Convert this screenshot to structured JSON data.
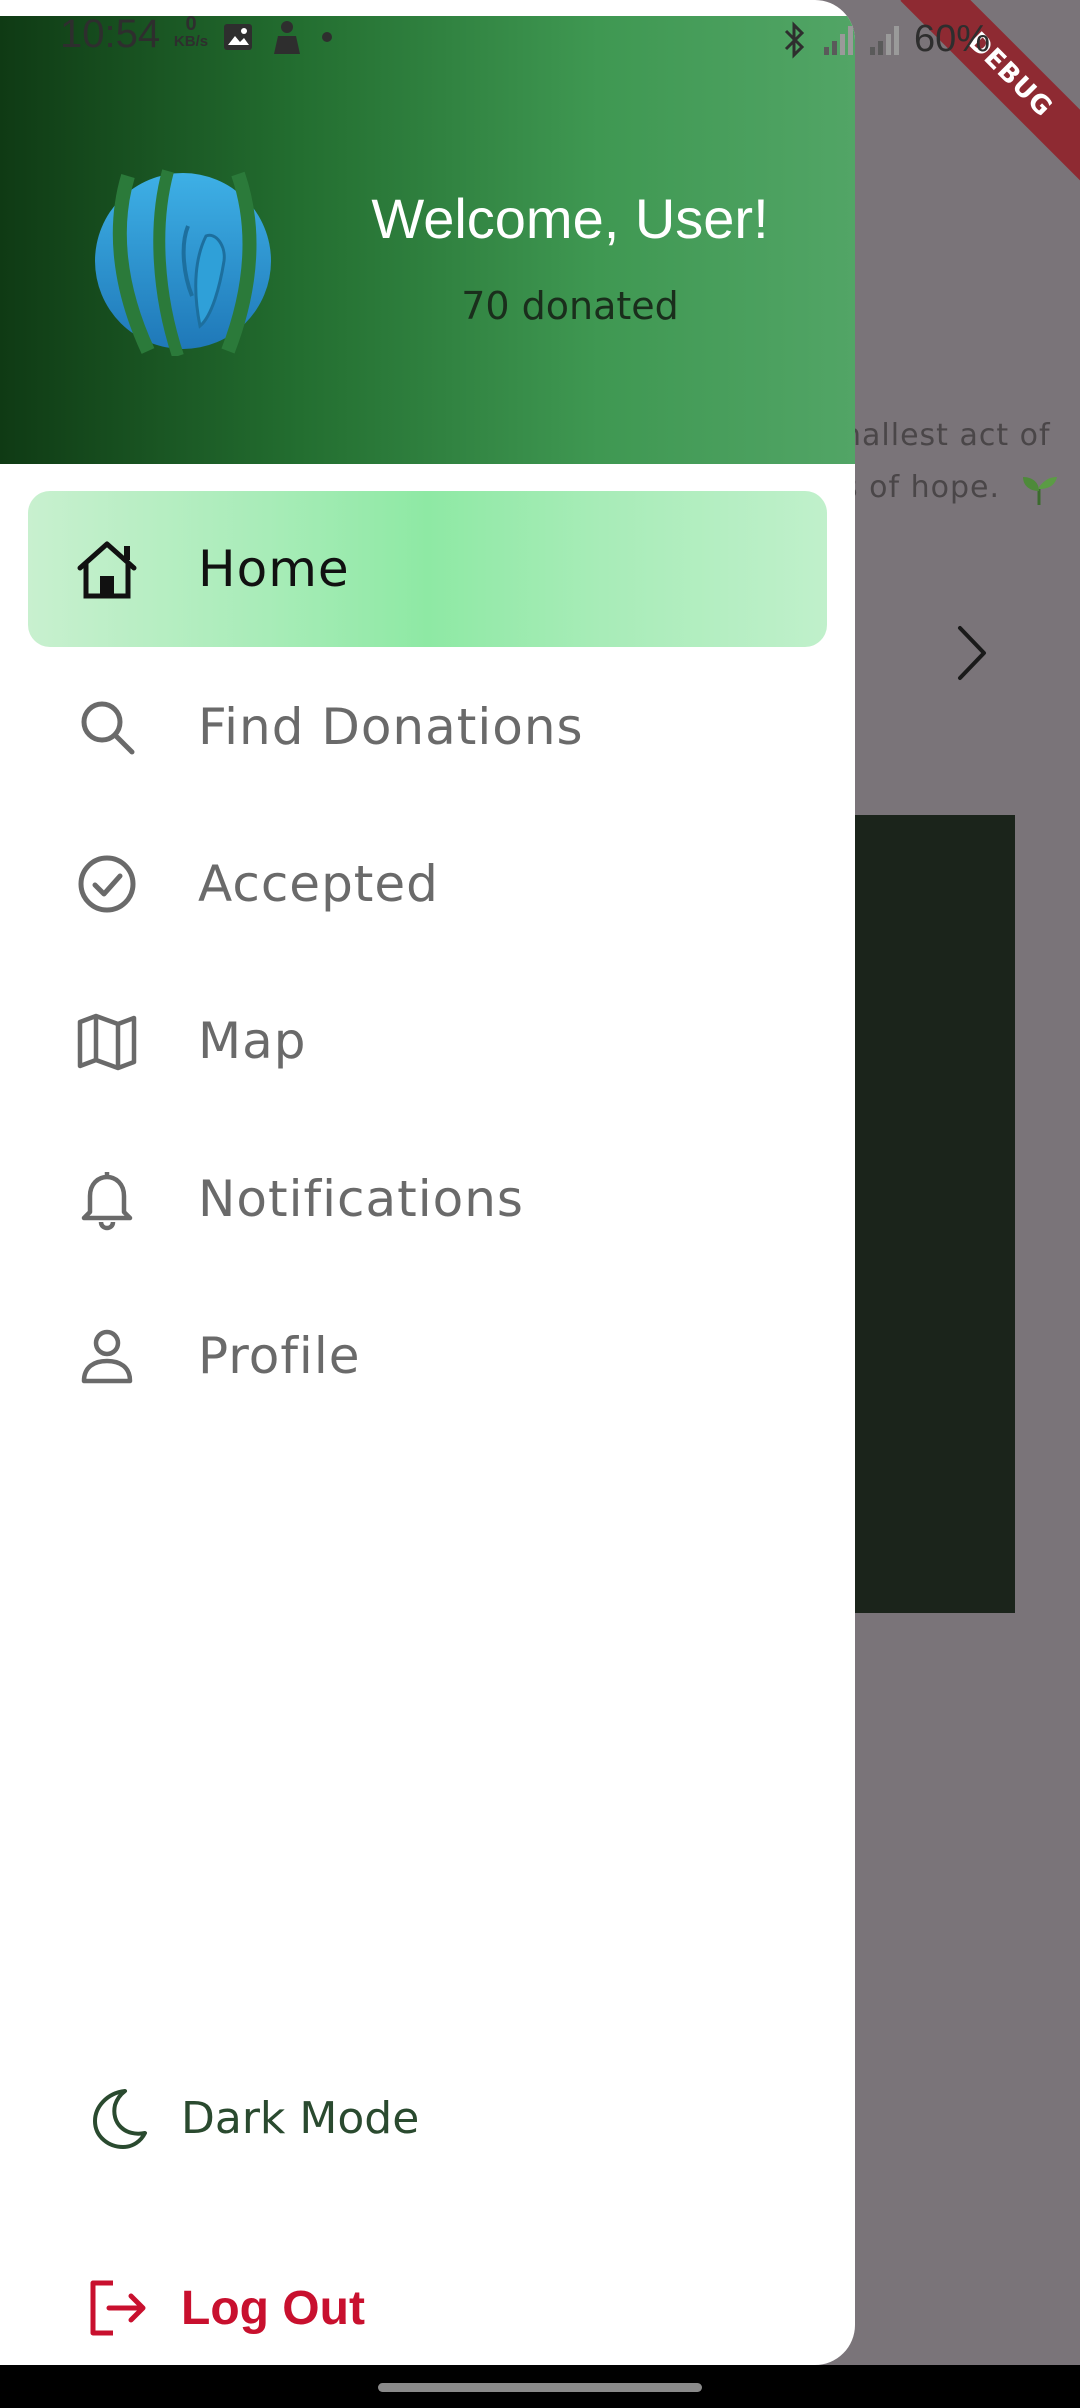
{
  "status_bar": {
    "time": "10:54",
    "net_speed_value": "0",
    "net_speed_unit": "KB/s",
    "battery": "60%"
  },
  "debug_banner": "DEBUG",
  "background": {
    "line1": "nallest act of",
    "line2": "s of hope."
  },
  "drawer": {
    "header": {
      "welcome": "Welcome, User!",
      "donated": "70 donated",
      "colors": {
        "start": "#0f3a14",
        "end": "#52a566"
      }
    },
    "menu": [
      {
        "label": "Home",
        "icon": "home-icon",
        "active": true
      },
      {
        "label": "Find Donations",
        "icon": "search-icon",
        "active": false
      },
      {
        "label": "Accepted",
        "icon": "check-circle-icon",
        "active": false
      },
      {
        "label": "Map",
        "icon": "map-icon",
        "active": false
      },
      {
        "label": "Notifications",
        "icon": "bell-icon",
        "active": false
      },
      {
        "label": "Profile",
        "icon": "person-icon",
        "active": false
      }
    ],
    "dark_mode_label": "Dark Mode",
    "logout_label": "Log Out"
  },
  "colors": {
    "accent": "#8ee9a4",
    "logout": "#c8102e",
    "scrim": "#7a7479"
  }
}
